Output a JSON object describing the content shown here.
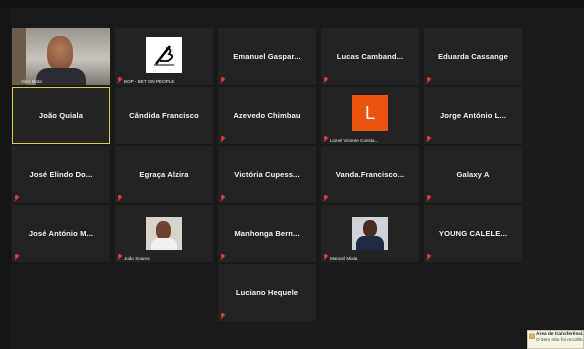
{
  "participants": [
    {
      "id": "vitor",
      "label": "Vitor Mota",
      "type": "video"
    },
    {
      "id": "bop",
      "label": "BOP - BET ON PEOPLE",
      "type": "image"
    },
    {
      "id": "emanuel",
      "name": "Emanuel Gaspar..."
    },
    {
      "id": "lucas",
      "name": "Lucas Camband..."
    },
    {
      "id": "eduarda",
      "name": "Eduarda Cassange"
    },
    {
      "id": "joao-quiala",
      "name": "João Quiala"
    },
    {
      "id": "candida",
      "name": "Cândida Francisco"
    },
    {
      "id": "azevedo",
      "name": "Azevedo Chimbau"
    },
    {
      "id": "lionel",
      "label": "Lionel Vicente Consta...",
      "avatar_letter": "L",
      "type": "letter"
    },
    {
      "id": "jorge",
      "name": "Jorge António L..."
    },
    {
      "id": "jose-elindo",
      "name": "José Elindo Do..."
    },
    {
      "id": "egraca",
      "name": "Egraça Alzira"
    },
    {
      "id": "victoria",
      "name": "Victória Cupess..."
    },
    {
      "id": "vanda",
      "name": "Vanda.Francisco..."
    },
    {
      "id": "galaxy",
      "name": "Galaxy A"
    },
    {
      "id": "jose-antonio",
      "name": "José António M..."
    },
    {
      "id": "joao-soares",
      "label": "João Soares",
      "type": "photo"
    },
    {
      "id": "manhonga",
      "name": "Manhonga Bern..."
    },
    {
      "id": "manuel",
      "label": "Manuel Miala",
      "type": "photo"
    },
    {
      "id": "young",
      "name": "YOUNG CALELE..."
    },
    {
      "id": "luciano",
      "name": "Luciano Hequele"
    }
  ],
  "popup": {
    "title": "Área de transferência",
    "text": "O item não foi recolhido"
  },
  "colors": {
    "active_border": "#d9cf47",
    "mic_muted": "#e23b3b",
    "tile_bg": "#232323",
    "letter_avatar_bg": "#e9540f"
  }
}
